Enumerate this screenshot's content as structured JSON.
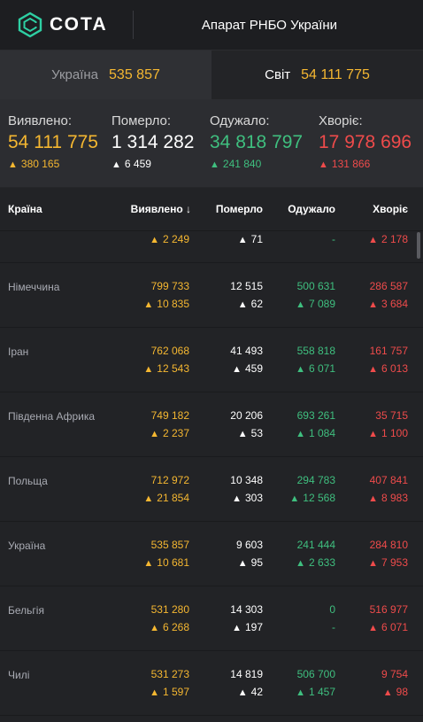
{
  "header": {
    "logo_text": "СОТА",
    "title": "Апарат РНБО України"
  },
  "scope": {
    "ukraine": {
      "label": "Україна",
      "value": "535 857"
    },
    "world": {
      "label": "Світ",
      "value": "54 111 775"
    }
  },
  "summary": {
    "detected": {
      "label": "Виявлено:",
      "value": "54 111 775",
      "delta": "380 165"
    },
    "died": {
      "label": "Померло:",
      "value": "1 314 282",
      "delta": "6 459"
    },
    "recovered": {
      "label": "Одужало:",
      "value": "34 818 797",
      "delta": "241 840"
    },
    "ill": {
      "label": "Хворіє:",
      "value": "17 978 696",
      "delta": "131 866"
    }
  },
  "table": {
    "headers": {
      "country": "Країна",
      "detected": "Виявлено",
      "died": "Померло",
      "recovered": "Одужало",
      "ill": "Хворіє"
    },
    "partial_row": {
      "detected_delta": "2 249",
      "died_delta": "71",
      "recovered_delta": "-",
      "ill_delta": "2 178"
    },
    "rows": [
      {
        "country": "Німеччина",
        "detected": "799 733",
        "detected_delta": "10 835",
        "died": "12 515",
        "died_delta": "62",
        "recovered": "500 631",
        "recovered_delta": "7 089",
        "ill": "286 587",
        "ill_delta": "3 684"
      },
      {
        "country": "Іран",
        "detected": "762 068",
        "detected_delta": "12 543",
        "died": "41 493",
        "died_delta": "459",
        "recovered": "558 818",
        "recovered_delta": "6 071",
        "ill": "161 757",
        "ill_delta": "6 013"
      },
      {
        "country": "Південна Африка",
        "detected": "749 182",
        "detected_delta": "2 237",
        "died": "20 206",
        "died_delta": "53",
        "recovered": "693 261",
        "recovered_delta": "1 084",
        "ill": "35 715",
        "ill_delta": "1 100"
      },
      {
        "country": "Польща",
        "detected": "712 972",
        "detected_delta": "21 854",
        "died": "10 348",
        "died_delta": "303",
        "recovered": "294 783",
        "recovered_delta": "12 568",
        "ill": "407 841",
        "ill_delta": "8 983"
      },
      {
        "country": "Україна",
        "detected": "535 857",
        "detected_delta": "10 681",
        "died": "9 603",
        "died_delta": "95",
        "recovered": "241 444",
        "recovered_delta": "2 633",
        "ill": "284 810",
        "ill_delta": "7 953"
      },
      {
        "country": "Бельгія",
        "detected": "531 280",
        "detected_delta": "6 268",
        "died": "14 303",
        "died_delta": "197",
        "recovered": "0",
        "recovered_delta": "-",
        "ill": "516 977",
        "ill_delta": "6 071"
      },
      {
        "country": "Чилі",
        "detected": "531 273",
        "detected_delta": "1 597",
        "died": "14 819",
        "died_delta": "42",
        "recovered": "506 700",
        "recovered_delta": "1 457",
        "ill": "9 754",
        "ill_delta": "98"
      }
    ]
  },
  "colors": {
    "detected": "#f5b731",
    "died": "#ffffff",
    "recovered": "#3fbf7f",
    "ill": "#ef4b4b"
  }
}
